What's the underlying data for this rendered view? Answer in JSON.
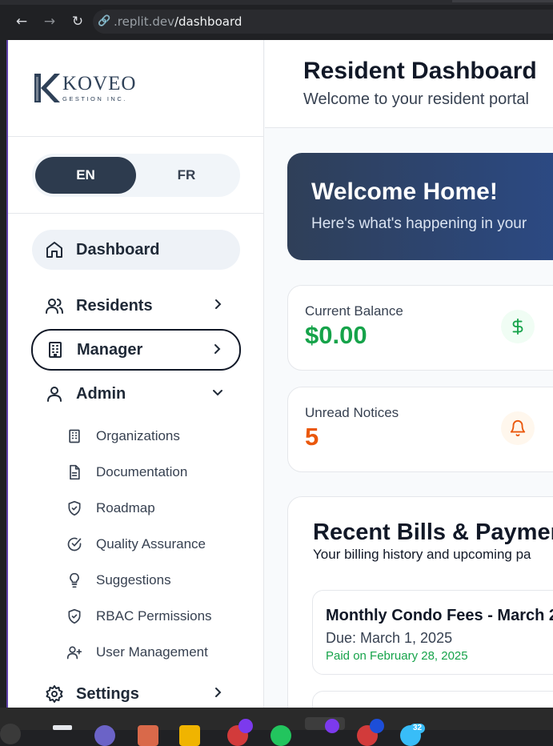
{
  "browser": {
    "url_prefix": ".replit.dev",
    "url_path": "/dashboard"
  },
  "sidebar": {
    "logo": {
      "name": "KOVEO",
      "tagline": "GESTION INC."
    },
    "language": {
      "en": "EN",
      "fr": "FR",
      "selected": "EN"
    },
    "nav": {
      "dashboard": "Dashboard",
      "residents": "Residents",
      "manager": "Manager",
      "admin": "Admin",
      "settings": "Settings"
    },
    "admin_items": [
      {
        "label": "Organizations",
        "icon": "building-icon"
      },
      {
        "label": "Documentation",
        "icon": "document-icon"
      },
      {
        "label": "Roadmap",
        "icon": "shield-icon"
      },
      {
        "label": "Quality Assurance",
        "icon": "check-circle-icon"
      },
      {
        "label": "Suggestions",
        "icon": "lightbulb-icon"
      },
      {
        "label": "RBAC Permissions",
        "icon": "shield-check-icon"
      },
      {
        "label": "User Management",
        "icon": "user-plus-icon"
      }
    ]
  },
  "header": {
    "title": "Resident Dashboard",
    "subtitle": "Welcome to your resident portal"
  },
  "hero": {
    "title": "Welcome Home!",
    "text": "Here's what's happening in your"
  },
  "stats": {
    "balance": {
      "label": "Current Balance",
      "value": "$0.00",
      "color": "#16a34a",
      "icon": "dollar-icon"
    },
    "notices": {
      "label": "Unread Notices",
      "value": "5",
      "color": "#ea580c",
      "icon": "bell-icon"
    }
  },
  "bills": {
    "title": "Recent Bills & Paymen",
    "subtitle": "Your billing history and upcoming pa",
    "items": [
      {
        "title": "Monthly Condo Fees - March 2",
        "due": "Due: March 1, 2025",
        "status": "Paid on February 28, 2025"
      }
    ]
  },
  "colors": {
    "accent_dark": "#2d3b4e",
    "hero_start": "#2f3f58",
    "hero_end": "#2b4a86",
    "success": "#16a34a",
    "warning": "#ea580c"
  },
  "taskbar": {
    "badge_count": "32"
  }
}
